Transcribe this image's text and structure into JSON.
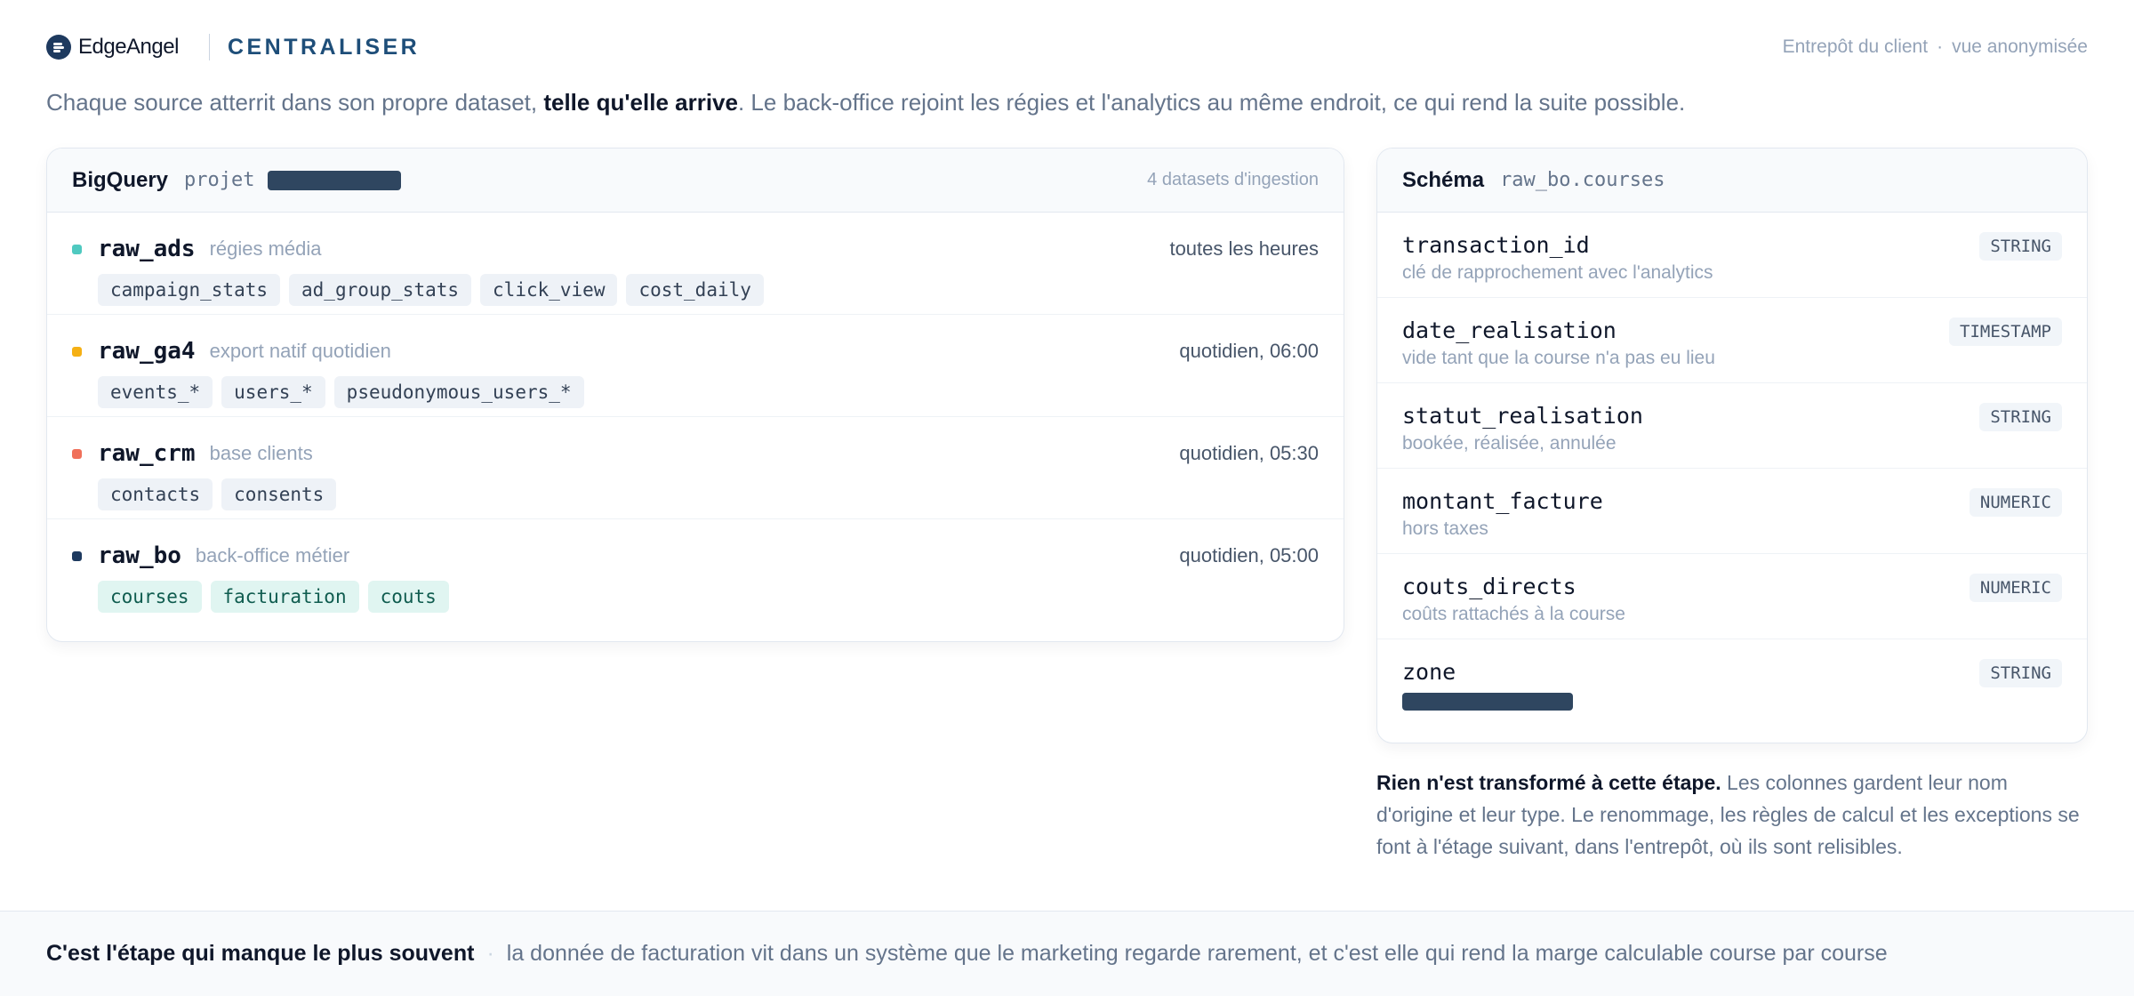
{
  "header": {
    "logo_icon": "edgeangel-logo-icon",
    "brand": "EdgeAngel",
    "section": "CENTRALISER",
    "client_label": "Entrepôt du client",
    "client_separator": "·",
    "client_view": "vue anonymisée"
  },
  "intro": {
    "before": "Chaque source atterrit dans son propre dataset, ",
    "emphasis": "telle qu'elle arrive",
    "after": ". Le back-office rejoint les régies et l'analytics au même endroit, ce qui rend la suite possible."
  },
  "bigquery": {
    "title": "BigQuery",
    "project_label": "projet",
    "project_name_redacted": true,
    "count_label": "4 datasets d'ingestion",
    "datasets": [
      {
        "name": "raw_ads",
        "desc": "régies média",
        "freq": "toutes les heures",
        "color": "#4fc9c0",
        "tags": [
          "campaign_stats",
          "ad_group_stats",
          "click_view",
          "cost_daily"
        ],
        "tag_style": "gray"
      },
      {
        "name": "raw_ga4",
        "desc": "export natif quotidien",
        "freq": "quotidien, 06:00",
        "color": "#f5b014",
        "tags": [
          "events_*",
          "users_*",
          "pseudonymous_users_*"
        ],
        "tag_style": "gray"
      },
      {
        "name": "raw_crm",
        "desc": "base clients",
        "freq": "quotidien, 05:30",
        "color": "#f0705a",
        "tags": [
          "contacts",
          "consents"
        ],
        "tag_style": "gray"
      },
      {
        "name": "raw_bo",
        "desc": "back-office métier",
        "freq": "quotidien, 05:00",
        "color": "#1e3a5f",
        "tags": [
          "courses",
          "facturation",
          "couts"
        ],
        "tag_style": "teal"
      }
    ]
  },
  "schema": {
    "title": "Schéma",
    "table": "raw_bo.courses",
    "fields": [
      {
        "name": "transaction_id",
        "type": "STRING",
        "desc": "clé de rapprochement avec l'analytics"
      },
      {
        "name": "date_realisation",
        "type": "TIMESTAMP",
        "desc": "vide tant que la course n'a pas eu lieu"
      },
      {
        "name": "statut_realisation",
        "type": "STRING",
        "desc": "bookée, réalisée, annulée"
      },
      {
        "name": "montant_facture",
        "type": "NUMERIC",
        "desc": "hors taxes"
      },
      {
        "name": "couts_directs",
        "type": "NUMERIC",
        "desc": "coûts rattachés à la course"
      },
      {
        "name": "zone",
        "type": "STRING",
        "desc": "",
        "desc_redacted": true
      }
    ]
  },
  "note": {
    "emphasis": "Rien n'est transformé à cette étape.",
    "text": " Les colonnes gardent leur nom d'origine et leur type. Le renommage, les règles de calcul et les exceptions se font à l'étage suivant, dans l'entrepôt, où ils sont relisibles."
  },
  "footer": {
    "emphasis": "C'est l'étape qui manque le plus souvent",
    "separator": "·",
    "text": "la donnée de facturation vit dans un système que le marketing regarde rarement, et c'est elle qui rend la marge calculable course par course"
  }
}
